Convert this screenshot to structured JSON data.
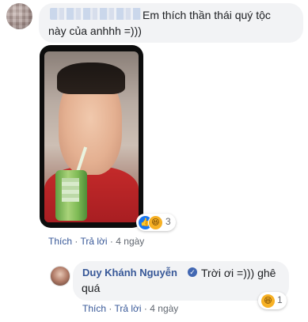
{
  "comment": {
    "text_line1": "Em thích thần thái quý tộc",
    "text_line2": "này của anhhh =)))",
    "reactions": {
      "like_icon": "like-icon",
      "haha_icon": "haha-icon",
      "count": "3"
    },
    "actions": {
      "like": "Thích",
      "reply": "Trả lời",
      "sep": "·",
      "time": "4 ngày"
    }
  },
  "reply": {
    "author": "Duy Khánh Nguyễn",
    "verified_icon": "verified-badge-icon",
    "text_line1": "Trời ơi =))) ghê",
    "text_line2": "quá",
    "reactions": {
      "haha_icon": "haha-icon",
      "count": "1"
    },
    "actions": {
      "like": "Thích",
      "reply": "Trả lời",
      "sep": "·",
      "time": "4 ngày"
    }
  },
  "colors": {
    "link": "#385898",
    "bubble": "#f2f3f5",
    "like_blue": "#1877f2",
    "haha_yellow": "#f7b125"
  }
}
